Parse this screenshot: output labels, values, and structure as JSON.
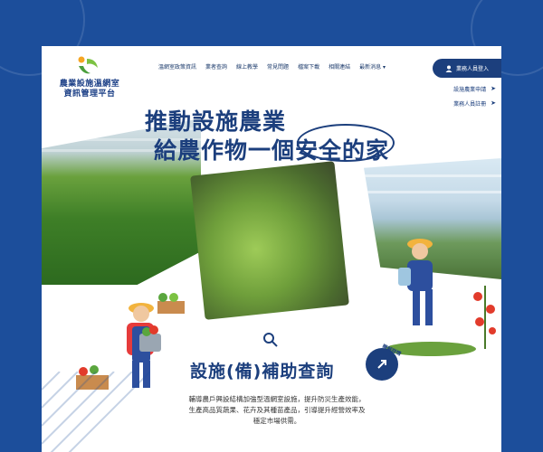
{
  "site": {
    "logo_line1": "農業設施溫網室",
    "logo_line2": "資訊管理平台"
  },
  "nav": {
    "items": [
      "溫網室政策資訊",
      "業者查詢",
      "線上教學",
      "常見問題",
      "檔案下載",
      "相關連結",
      "最新消息 ▾"
    ]
  },
  "auth": {
    "login_label": "業務人員登入",
    "apply_label": "設施農業申請",
    "staff_label": "業務人員註冊"
  },
  "hero": {
    "headline_line1": "推動設施農業",
    "headline_line2": "給農作物一個安全的家"
  },
  "section": {
    "title": "設施(備)補助查詢",
    "more_label": "瞭解詳情",
    "desc_line1": "輔導農戶興設結構加強型溫網室設施，提升防災生產效能，",
    "desc_line2": "生產高品質蔬果、花卉及其種苗產品，引導提升經營效率及",
    "desc_line3": "穩定市場供需。"
  },
  "colors": {
    "brand": "#1c3f7d",
    "background": "#1c4e9b"
  }
}
